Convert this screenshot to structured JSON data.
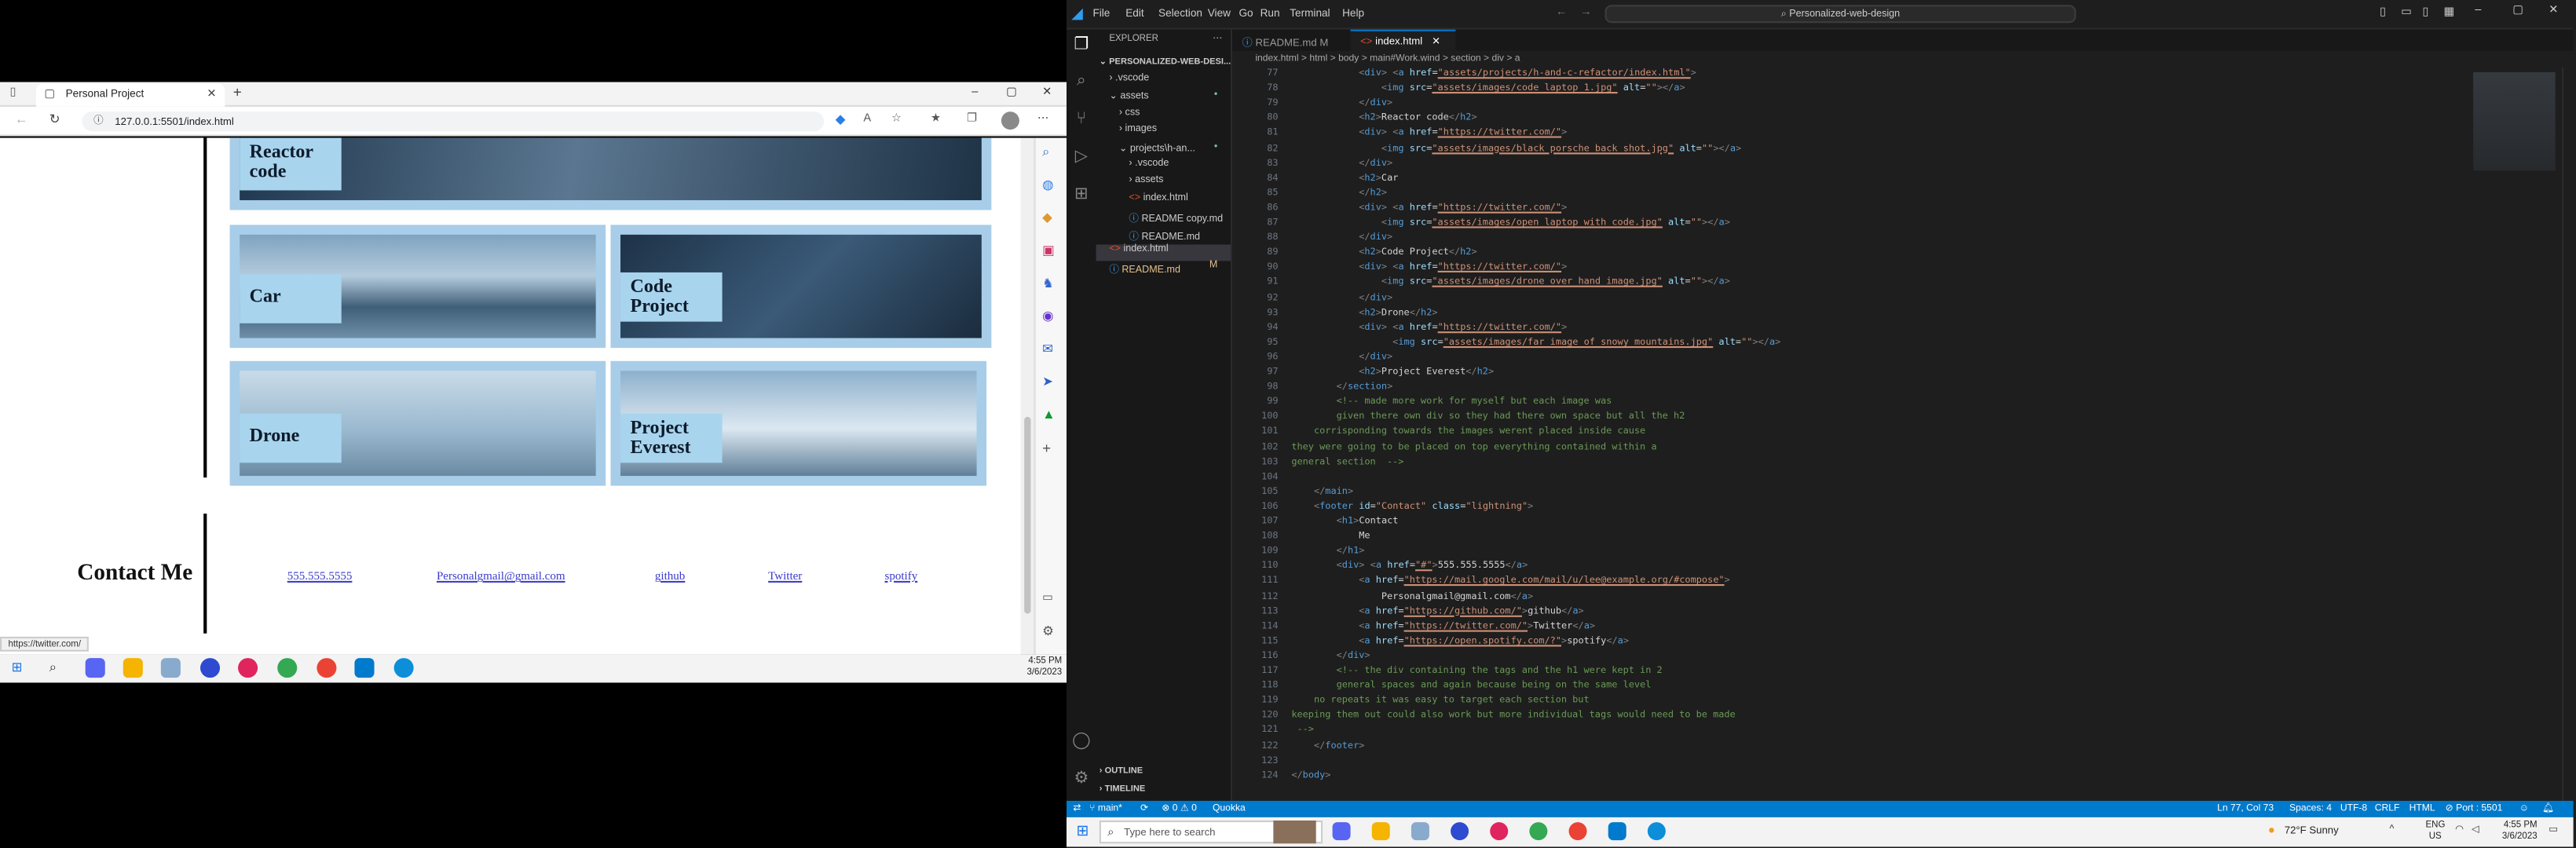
{
  "browser": {
    "tab_title": "Personal Project",
    "url": "127.0.0.1:5501/index.html",
    "status_url": "https://twitter.com/",
    "gallery": [
      "Reactor code",
      "Car",
      "Code Project",
      "Drone",
      "Project Everest"
    ],
    "contact_heading": "Contact Me",
    "footer_links": [
      "555.555.5555",
      "Personalgmail@gmail.com",
      "github",
      "Twitter",
      "spotify"
    ]
  },
  "left_taskbar": {
    "time": "4:55 PM",
    "date": "3/6/2023"
  },
  "vscode": {
    "menu": [
      "File",
      "Edit",
      "Selection",
      "View",
      "Go",
      "Run",
      "Terminal",
      "Help"
    ],
    "search": "Personalized-web-design",
    "explorer_title": "EXPLORER",
    "project": "PERSONALIZED-WEB-DESI...",
    "tree": [
      {
        "label": ".vscode",
        "indent": 1,
        "kind": "folder"
      },
      {
        "label": "assets",
        "indent": 1,
        "kind": "folder-open",
        "badge": "•"
      },
      {
        "label": "css",
        "indent": 2,
        "kind": "folder"
      },
      {
        "label": "images",
        "indent": 2,
        "kind": "folder"
      },
      {
        "label": "projects\\h-an...",
        "indent": 2,
        "kind": "folder-open",
        "badge": "•"
      },
      {
        "label": ".vscode",
        "indent": 3,
        "kind": "folder"
      },
      {
        "label": "assets",
        "indent": 3,
        "kind": "folder"
      },
      {
        "label": "index.html",
        "indent": 3,
        "kind": "html"
      },
      {
        "label": "README copy.md",
        "indent": 3,
        "kind": "md"
      },
      {
        "label": "README.md",
        "indent": 3,
        "kind": "md"
      },
      {
        "label": "index.html",
        "indent": 1,
        "kind": "html",
        "selected": true
      },
      {
        "label": "README.md",
        "indent": 1,
        "kind": "md",
        "badge": "M"
      }
    ],
    "outline": "OUTLINE",
    "timeline": "TIMELINE",
    "tabs": [
      {
        "label": "README.md M",
        "active": false
      },
      {
        "label": "index.html",
        "active": true
      }
    ],
    "breadcrumb": "index.html  >  html  >  body  >  main#Work.wind  >  section  >  div  >  a",
    "code": [
      [
        77,
        "            <div> <a href=\"assets/projects/h-and-c-refactor/index.html\">"
      ],
      [
        78,
        "                <img src=\"assets/images/code laptop 1.jpg\" alt=\"\"></a>"
      ],
      [
        79,
        "            </div>"
      ],
      [
        80,
        "            <h2>Reactor code</h2>"
      ],
      [
        81,
        "            <div> <a href=\"https://twitter.com/\">"
      ],
      [
        82,
        "                <img src=\"assets/images/black porsche back shot.jpg\" alt=\"\"></a>"
      ],
      [
        83,
        "            </div>"
      ],
      [
        84,
        "            <h2>Car"
      ],
      [
        85,
        "            </h2>"
      ],
      [
        86,
        "            <div> <a href=\"https://twitter.com/\">"
      ],
      [
        87,
        "                <img src=\"assets/images/open laptop with code.jpg\" alt=\"\"></a>"
      ],
      [
        88,
        "            </div>"
      ],
      [
        89,
        "            <h2>Code Project</h2>"
      ],
      [
        90,
        "            <div> <a href=\"https://twitter.com/\">"
      ],
      [
        91,
        "                <img src=\"assets/images/drone over hand image.jpg\" alt=\"\"></a>"
      ],
      [
        92,
        "            </div>"
      ],
      [
        93,
        "            <h2>Drone</h2>"
      ],
      [
        94,
        "            <div> <a href=\"https://twitter.com/\">"
      ],
      [
        95,
        "                  <img src=\"assets/images/far image of snowy mountains.jpg\" alt=\"\"></a>"
      ],
      [
        96,
        "            </div>"
      ],
      [
        97,
        "            <h2>Project Everest</h2>"
      ],
      [
        98,
        "        </section>"
      ],
      [
        99,
        "        <!-- made more work for myself but each image was"
      ],
      [
        100,
        "        given there own div so they had there own space but all the h2"
      ],
      [
        101,
        "    corrisponding towards the images werent placed inside cause"
      ],
      [
        102,
        "they were going to be placed on top everything contained within a"
      ],
      [
        103,
        "general section  -->"
      ],
      [
        104,
        ""
      ],
      [
        105,
        "    </main>"
      ],
      [
        106,
        "    <footer id=\"Contact\" class=\"lightning\">"
      ],
      [
        107,
        "        <h1>Contact"
      ],
      [
        108,
        "            Me"
      ],
      [
        109,
        "        </h1>"
      ],
      [
        110,
        "        <div> <a href=\"#\">555.555.5555</a>"
      ],
      [
        111,
        "            <a href=\"https://mail.google.com/mail/u/lee@example.org/#compose\">"
      ],
      [
        112,
        "                Personalgmail@gmail.com</a>"
      ],
      [
        113,
        "            <a href=\"https://github.com/\">github</a>"
      ],
      [
        114,
        "            <a href=\"https://twitter.com/\">Twitter</a>"
      ],
      [
        115,
        "            <a href=\"https://open.spotify.com/?\">spotify</a>"
      ],
      [
        116,
        "        </div>"
      ],
      [
        117,
        "        <!-- the div containing the tags and the h1 were kept in 2"
      ],
      [
        118,
        "        general spaces and again because being on the same level"
      ],
      [
        119,
        "    no repeats it was easy to target each section but"
      ],
      [
        120,
        "keeping them out could also work but more individual tags would need to be made"
      ],
      [
        121,
        " -->"
      ],
      [
        122,
        "    </footer>"
      ],
      [
        123,
        ""
      ],
      [
        124,
        "</body>"
      ]
    ],
    "status": {
      "branch": "main*",
      "sync": "⟳",
      "problems": "⊗ 0 ⚠ 0",
      "quokka": "Quokka",
      "position": "Ln 77, Col 73",
      "spaces": "Spaces: 4",
      "encoding": "UTF-8",
      "eol": "CRLF",
      "language": "HTML",
      "port": "⊘ Port : 5501"
    }
  },
  "right_taskbar": {
    "search": "Type here to search",
    "weather": "72°F  Sunny",
    "lang": "ENG",
    "region": "US",
    "time": "4:55 PM",
    "date": "3/6/2023"
  },
  "colors": {
    "tile": "#a8cde8",
    "vscode_blue": "#007acc",
    "link": "#3b3bcc"
  }
}
